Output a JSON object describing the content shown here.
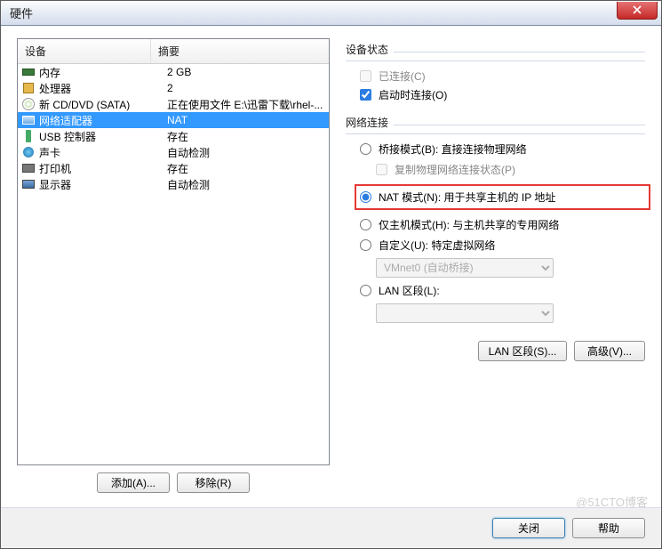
{
  "window": {
    "title": "硬件"
  },
  "table": {
    "headers": {
      "device": "设备",
      "summary": "摘要"
    },
    "rows": [
      {
        "icon": "memory",
        "device": "内存",
        "summary": "2 GB",
        "selected": false
      },
      {
        "icon": "cpu",
        "device": "处理器",
        "summary": "2",
        "selected": false
      },
      {
        "icon": "cd",
        "device": "新 CD/DVD (SATA)",
        "summary": "正在使用文件 E:\\迅雷下载\\rhel-...",
        "selected": false
      },
      {
        "icon": "net",
        "device": "网络适配器",
        "summary": "NAT",
        "selected": true
      },
      {
        "icon": "usb",
        "device": "USB 控制器",
        "summary": "存在",
        "selected": false
      },
      {
        "icon": "sound",
        "device": "声卡",
        "summary": "自动检测",
        "selected": false
      },
      {
        "icon": "printer",
        "device": "打印机",
        "summary": "存在",
        "selected": false
      },
      {
        "icon": "display",
        "device": "显示器",
        "summary": "自动检测",
        "selected": false
      }
    ]
  },
  "left_buttons": {
    "add": "添加(A)...",
    "remove": "移除(R)"
  },
  "status_group": {
    "title": "设备状态",
    "connected": "已连接(C)",
    "connect_on_start": "启动时连接(O)"
  },
  "network_group": {
    "title": "网络连接",
    "bridged": "桥接模式(B): 直接连接物理网络",
    "replicate": "复制物理网络连接状态(P)",
    "nat": "NAT 模式(N): 用于共享主机的 IP 地址",
    "hostonly": "仅主机模式(H): 与主机共享的专用网络",
    "custom": "自定义(U): 特定虚拟网络",
    "custom_select": "VMnet0 (自动桥接)",
    "lan_segment": "LAN 区段(L):"
  },
  "right_buttons": {
    "lan": "LAN 区段(S)...",
    "adv": "高级(V)..."
  },
  "bottom": {
    "close": "关闭",
    "help": "帮助"
  },
  "watermark": "@51CTO博客"
}
